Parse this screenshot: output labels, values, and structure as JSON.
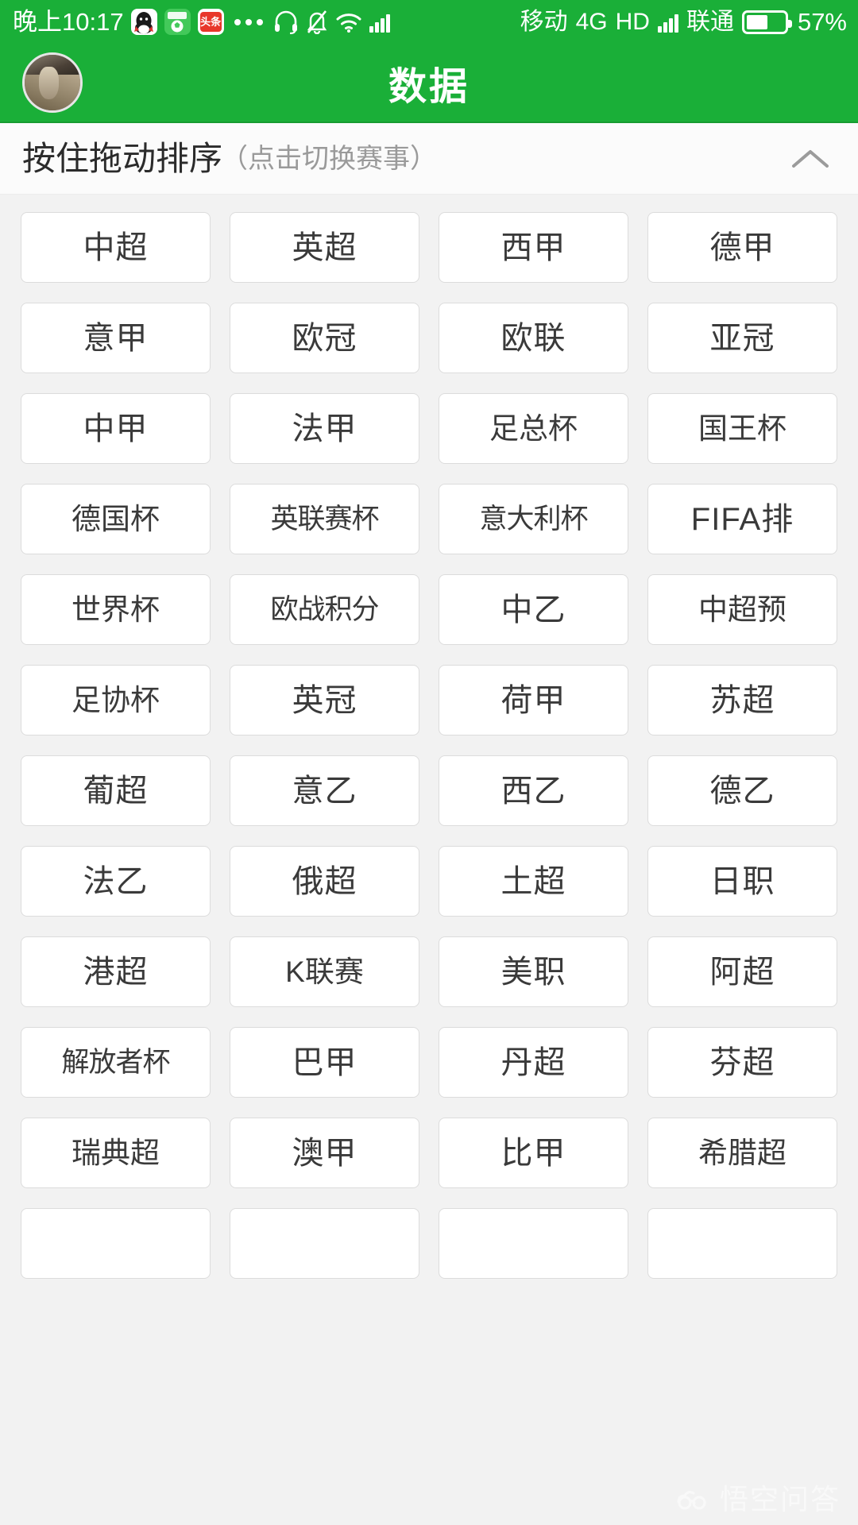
{
  "status_bar": {
    "time": "晚上10:17",
    "carrier_primary": "移动",
    "network_type": "4G",
    "hd_label": "HD",
    "carrier_secondary": "联通",
    "battery_percent": "57%",
    "icons": [
      "qq-icon",
      "soccer-app-icon",
      "toutiao-icon",
      "more-dots-icon",
      "headset-icon",
      "bell-muted-icon",
      "wifi-icon",
      "signal-bars-icon",
      "signal-bars-secondary-icon",
      "battery-icon"
    ],
    "qq_glyph": "🐧",
    "toutiao_glyph": "头条",
    "ball_glyph": "⚽"
  },
  "app_bar": {
    "title": "数据",
    "avatar_name": "user-avatar"
  },
  "section_header": {
    "main_label": "按住拖动排序",
    "sub_label": "（点击切换赛事）",
    "collapse_icon": "chevron-up-icon"
  },
  "leagues": [
    "中超",
    "英超",
    "西甲",
    "德甲",
    "意甲",
    "欧冠",
    "欧联",
    "亚冠",
    "中甲",
    "法甲",
    "足总杯",
    "国王杯",
    "德国杯",
    "英联赛杯",
    "意大利杯",
    "FIFA排",
    "世界杯",
    "欧战积分",
    "中乙",
    "中超预",
    "足协杯",
    "英冠",
    "荷甲",
    "苏超",
    "葡超",
    "意乙",
    "西乙",
    "德乙",
    "法乙",
    "俄超",
    "土超",
    "日职",
    "港超",
    "K联赛",
    "美职",
    "阿超",
    "解放者杯",
    "巴甲",
    "丹超",
    "芬超",
    "瑞典超",
    "澳甲",
    "比甲",
    "希腊超",
    "",
    "",
    "",
    ""
  ],
  "watermark": {
    "text": "悟空问答",
    "logo_name": "wukong-cloud-logo"
  },
  "colors": {
    "brand_green": "#1aaf38",
    "page_bg": "#f2f2f2",
    "tile_bg": "#ffffff",
    "tile_border": "#dcdcdc",
    "text_primary": "#3a3a3a",
    "text_muted": "#9a9a9a"
  }
}
